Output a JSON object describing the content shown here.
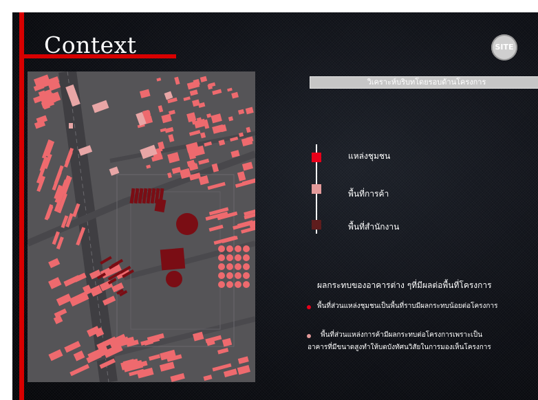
{
  "slide": {
    "title": "Context",
    "badge": "SITE",
    "section_heading": "วิเคราะห์บริบทโดยรอบด้านโครงการ"
  },
  "legend": {
    "items": [
      {
        "label": "แหล่งชุมชน",
        "color": "#e8001a"
      },
      {
        "label": "พื้นที่การค้า",
        "color": "#e39a9a"
      },
      {
        "label": "พื้นที่สำนักงาน",
        "color": "#5e1d1d"
      }
    ]
  },
  "impacts": {
    "title": "ผลกระทบของอาคารต่าง ๆที่มีผลต่อพื้นที่โครงการ",
    "items": [
      {
        "bullet_color": "#e8001a",
        "lines": [
          "พื้นที่ส่วนแหล่งชุมชนเป็นพื้นที่ราบมีผลกระทบน้อยต่อโครงการ"
        ]
      },
      {
        "bullet_color": "#e39a9a",
        "lines": [
          "พื้นที่ส่วนแหล่งการค้ามีผลกระทบต่อโครงการเพราะเป็น",
          "อาคารที่มีขนาดสูงทำให้บดบังทัศนวิสัยในการมองเห็นโครงการ"
        ]
      }
    ]
  },
  "colors": {
    "accent_red": "#d80000",
    "community": "#e8001a",
    "commercial": "#e39a9a",
    "office": "#5e1d1d",
    "map_building": "#ee6a6e"
  },
  "map": {
    "description_icon": "site-plan-map"
  }
}
